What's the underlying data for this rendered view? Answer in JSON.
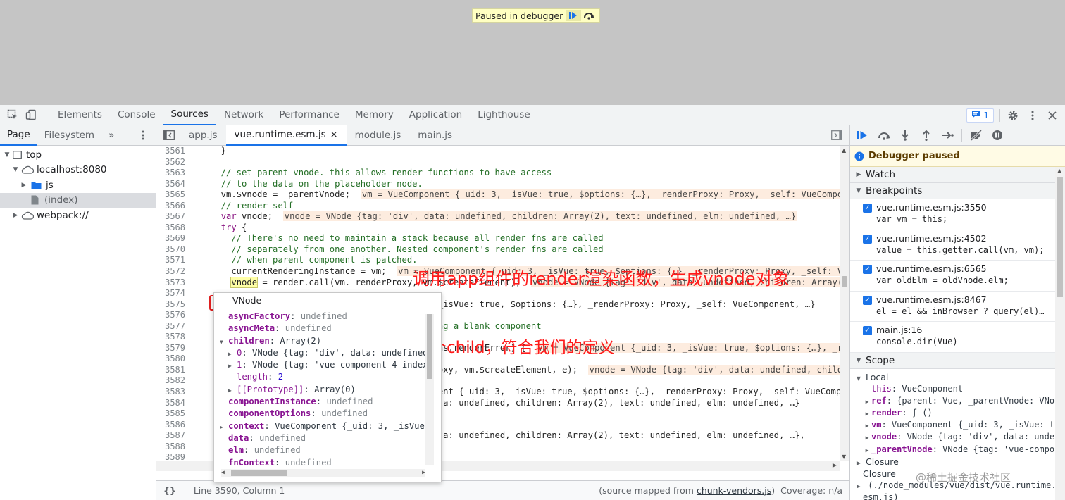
{
  "banner": {
    "text": "Paused in debugger",
    "resume_icon": "resume-icon",
    "step_over_icon": "step-over-icon"
  },
  "devtools_tabs": [
    "Elements",
    "Console",
    "Sources",
    "Network",
    "Performance",
    "Memory",
    "Application",
    "Lighthouse"
  ],
  "issues_count": "1",
  "navigator": {
    "tabs": [
      "Page",
      "Filesystem"
    ],
    "more": "»",
    "tree": [
      {
        "label": "top",
        "depth": 0,
        "expanded": true
      },
      {
        "label": "localhost:8080",
        "depth": 1,
        "expanded": true
      },
      {
        "label": "js",
        "depth": 2,
        "expanded": false
      },
      {
        "label": "(index)",
        "depth": 2,
        "selected": true
      },
      {
        "label": "webpack://",
        "depth": 1,
        "expanded": false
      }
    ]
  },
  "editor_tabs": [
    "app.js",
    "vue.runtime.esm.js",
    "module.js",
    "main.js"
  ],
  "active_editor_tab": "vue.runtime.esm.js",
  "code": [
    {
      "n": "3561",
      "text": "  }",
      "cls": "",
      "inline": ""
    },
    {
      "n": "3562",
      "text": "",
      "cls": "",
      "inline": ""
    },
    {
      "n": "3563",
      "text": "  // set parent vnode. this allows render functions to have access",
      "cls": "cm",
      "inline": ""
    },
    {
      "n": "3564",
      "text": "  // to the data on the placeholder node.",
      "cls": "cm",
      "inline": ""
    },
    {
      "n": "3565",
      "text": "  vm.$vnode = _parentVnode;",
      "cls": "",
      "inline": "vm = VueComponent {_uid: 3, _isVue: true, $options: {…}, _renderProxy: Proxy, _self: VueComponent, …}"
    },
    {
      "n": "3566",
      "text": "  // render self",
      "cls": "cm",
      "inline": ""
    },
    {
      "n": "3567",
      "text": "  var vnode;",
      "cls": "",
      "inline": "vnode = VNode {tag: 'div', data: undefined, children: Array(2), text: undefined, elm: undefined, …}"
    },
    {
      "n": "3568",
      "text": "  try {",
      "cls": "",
      "inline": ""
    },
    {
      "n": "3569",
      "text": "    // There's no need to maintain a stack because all render fns are called",
      "cls": "cm",
      "inline": ""
    },
    {
      "n": "3570",
      "text": "    // separately from one another. Nested component's render fns are called",
      "cls": "cm",
      "inline": ""
    },
    {
      "n": "3571",
      "text": "    // when parent component is patched.",
      "cls": "cm",
      "inline": ""
    },
    {
      "n": "3572",
      "text": "    currentRenderingInstance = vm;",
      "cls": "",
      "inline": "vm = VueComponent {_uid: 3, _isVue: true, $options: {…}, _renderProxy: Proxy, _self: VueComponent, …}"
    },
    {
      "n": "3573",
      "text": "    vnode = render.call(vm._renderProxy, vm.$createElement);",
      "cls": "",
      "inline": "vnode = VNode {tag: 'div', data: undefined, children: Array(2), text: undefined, elm: undefined, …}"
    },
    {
      "n": "3574",
      "text": "",
      "cls": "",
      "inline": ""
    },
    {
      "n": "3575",
      "text": "                                  {_uid: 3, _isVue: true, $options: {…}, _renderProxy: Proxy, _self: VueComponent, …}",
      "cls": "",
      "inline": ""
    },
    {
      "n": "3576",
      "text": "",
      "cls": "",
      "inline": ""
    },
    {
      "n": "3577",
      "text": "                                     rendering a blank component",
      "cls": "cm",
      "inline": ""
    },
    {
      "n": "3578",
      "text": "",
      "cls": "",
      "inline": ""
    },
    {
      "n": "3579",
      "text": "                                   vm.$options.renderError) {",
      "cls": "",
      "inline": "vm = VueComponent {_uid: 3, _isVue: true, $options: {…}, _renderProxy: Proxy, _self: VueComponent, …}"
    },
    {
      "n": "3580",
      "text": "",
      "cls": "",
      "inline": ""
    },
    {
      "n": "3581",
      "text": "                                   _renderProxy, vm.$createElement, e);",
      "cls": "",
      "inline": "vnode = VNode {tag: 'div', data: undefined, children: Array(2), text: undefined, elm: undefined, …}"
    },
    {
      "n": "3582",
      "text": "",
      "cls": "",
      "inline": ""
    },
    {
      "n": "3583",
      "text": "                                   VueComponent {_uid: 3, _isVue: true, $options: {…}, _renderProxy: Proxy, _self: VueComponent, …}",
      "cls": "",
      "inline": ""
    },
    {
      "n": "3584",
      "text": "                                   'div', data: undefined, children: Array(2), text: undefined, elm: undefined, …}",
      "cls": "",
      "inline": ""
    },
    {
      "n": "3585",
      "text": "",
      "cls": "",
      "inline": ""
    },
    {
      "n": "3586",
      "text": "",
      "cls": "",
      "inline": ""
    },
    {
      "n": "3587",
      "text": "                                   'div', data: undefined, children: Array(2), text: undefined, elm: undefined, …},",
      "cls": "",
      "inline": ""
    },
    {
      "n": "3588",
      "text": "",
      "cls": "",
      "inline": ""
    },
    {
      "n": "3589",
      "text": "",
      "cls": "",
      "inline": ""
    }
  ],
  "annotations": {
    "render_note": "调用app组件的render渲染函数，生成vnode对象",
    "child_note": "他有两个child，符合我们的定义"
  },
  "popover": {
    "title": "VNode",
    "rows": [
      {
        "indent": 0,
        "tri": "",
        "key": "asyncFactory",
        "val": "undefined",
        "vcls": "pv-undef"
      },
      {
        "indent": 0,
        "tri": "",
        "key": "asyncMeta",
        "val": "undefined",
        "vcls": "pv-undef"
      },
      {
        "indent": 0,
        "tri": "▼",
        "key": "children",
        "val": "Array(2)",
        "vcls": ""
      },
      {
        "indent": 1,
        "tri": "▶",
        "key": "0",
        "val": "VNode {tag: 'div', data: undefined,",
        "vcls": ""
      },
      {
        "indent": 1,
        "tri": "▶",
        "key": "1",
        "val": "VNode {tag: 'vue-component-4-index",
        "vcls": ""
      },
      {
        "indent": 1,
        "tri": "",
        "key": "length",
        "val": "2",
        "vcls": "pv-num"
      },
      {
        "indent": 1,
        "tri": "▶",
        "key": "[[Prototype]]",
        "val": "Array(0)",
        "vcls": ""
      },
      {
        "indent": 0,
        "tri": "",
        "key": "componentInstance",
        "val": "undefined",
        "vcls": "pv-undef"
      },
      {
        "indent": 0,
        "tri": "",
        "key": "componentOptions",
        "val": "undefined",
        "vcls": "pv-undef"
      },
      {
        "indent": 0,
        "tri": "▶",
        "key": "context",
        "val": "VueComponent {_uid: 3, _isVue:",
        "vcls": ""
      },
      {
        "indent": 0,
        "tri": "",
        "key": "data",
        "val": "undefined",
        "vcls": "pv-undef"
      },
      {
        "indent": 0,
        "tri": "",
        "key": "elm",
        "val": "undefined",
        "vcls": "pv-undef"
      },
      {
        "indent": 0,
        "tri": "",
        "key": "fnContext",
        "val": "undefined",
        "vcls": "pv-undef"
      }
    ]
  },
  "status": {
    "braces": "{}",
    "position": "Line 3590, Column 1",
    "source_mapped_prefix": "(source mapped from ",
    "source_mapped_file": "chunk-vendors.js",
    "source_mapped_suffix": ")",
    "coverage": "Coverage: n/a"
  },
  "debugger": {
    "paused_label": "Debugger paused",
    "watch_label": "Watch",
    "breakpoints_label": "Breakpoints",
    "breakpoints": [
      {
        "file": "vue.runtime.esm.js:3550",
        "code": "var vm = this;"
      },
      {
        "file": "vue.runtime.esm.js:4502",
        "code": "value = this.getter.call(vm, vm);"
      },
      {
        "file": "vue.runtime.esm.js:6565",
        "code": "var oldElm = oldVnode.elm;"
      },
      {
        "file": "vue.runtime.esm.js:8467",
        "code": "el = el && inBrowser ? query(el)…"
      },
      {
        "file": "main.js:16",
        "code": "console.dir(Vue)"
      }
    ],
    "scope_label": "Scope",
    "local_label": "Local",
    "scope_rows": [
      {
        "tri": "",
        "key": "this",
        "val": "VueComponent"
      },
      {
        "tri": "▶",
        "key": "ref",
        "val": "{parent: Vue, _parentVnode: VNod"
      },
      {
        "tri": "▶",
        "key": "render",
        "val": "ƒ ()"
      },
      {
        "tri": "▶",
        "key": "vm",
        "val": "VueComponent {_uid: 3, _isVue: tr"
      },
      {
        "tri": "▶",
        "key": "vnode",
        "val": "VNode {tag: 'div', data: undef"
      },
      {
        "tri": "▶",
        "key": "_parentVnode",
        "val": "VNode {tag: 'vue-compon"
      }
    ],
    "closure_label": "Closure",
    "closure2_label": "Closure",
    "closure2_path": "(./node_modules/vue/dist/vue.runtime.",
    "closure2_path2": "esm.js)"
  },
  "watermark": "@稀土掘金技术社区",
  "colors": {
    "accent": "#1a73e8",
    "annotation": "#ff1a1a",
    "comment": "#236e25"
  }
}
